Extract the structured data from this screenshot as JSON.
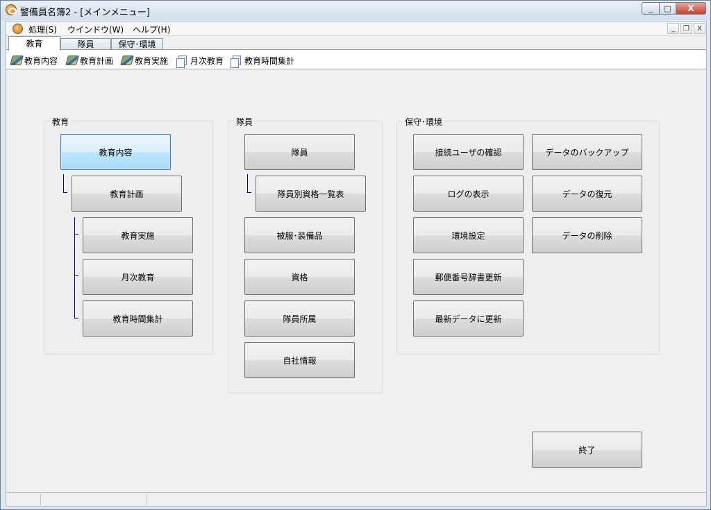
{
  "window": {
    "title": "警備員名簿2 - [メインメニュー]",
    "min_glyph": "_",
    "max_glyph": "□",
    "close_glyph": "X"
  },
  "menubar": {
    "items": [
      "処理(S)",
      "ウインドウ(W)",
      "ヘルプ(H)"
    ],
    "mdi_min": "_",
    "mdi_restore": "❐",
    "mdi_close": "X"
  },
  "tabs": [
    "教育",
    "隊員",
    "保守･環境"
  ],
  "toolbar": {
    "items": [
      {
        "label": "教育内容",
        "icon": "book-icon"
      },
      {
        "label": "教育計画",
        "icon": "book-icon"
      },
      {
        "label": "教育実施",
        "icon": "book-icon"
      },
      {
        "label": "月次教育",
        "icon": "document-icon"
      },
      {
        "label": "教育時間集計",
        "icon": "document-icon"
      }
    ]
  },
  "groups": {
    "education": {
      "title": "教育",
      "buttons": [
        "教育内容",
        "教育計画",
        "教育実施",
        "月次教育",
        "教育時間集計"
      ]
    },
    "members": {
      "title": "隊員",
      "buttons": [
        "隊員",
        "隊員別資格一覧表",
        "被服･装備品",
        "資格",
        "隊員所属",
        "自社情報"
      ]
    },
    "maintenance": {
      "title": "保守･環境",
      "buttons": [
        "接続ユーザの確認",
        "ログの表示",
        "環境設定",
        "郵便番号辞書更新",
        "最新データに更新",
        "データのバックアップ",
        "データの復元",
        "データの削除"
      ]
    }
  },
  "exit_button": "終了",
  "colors": {
    "accent_focus": "#3c7fb1",
    "tree_line": "#000080",
    "close_red": "#c4402d"
  }
}
